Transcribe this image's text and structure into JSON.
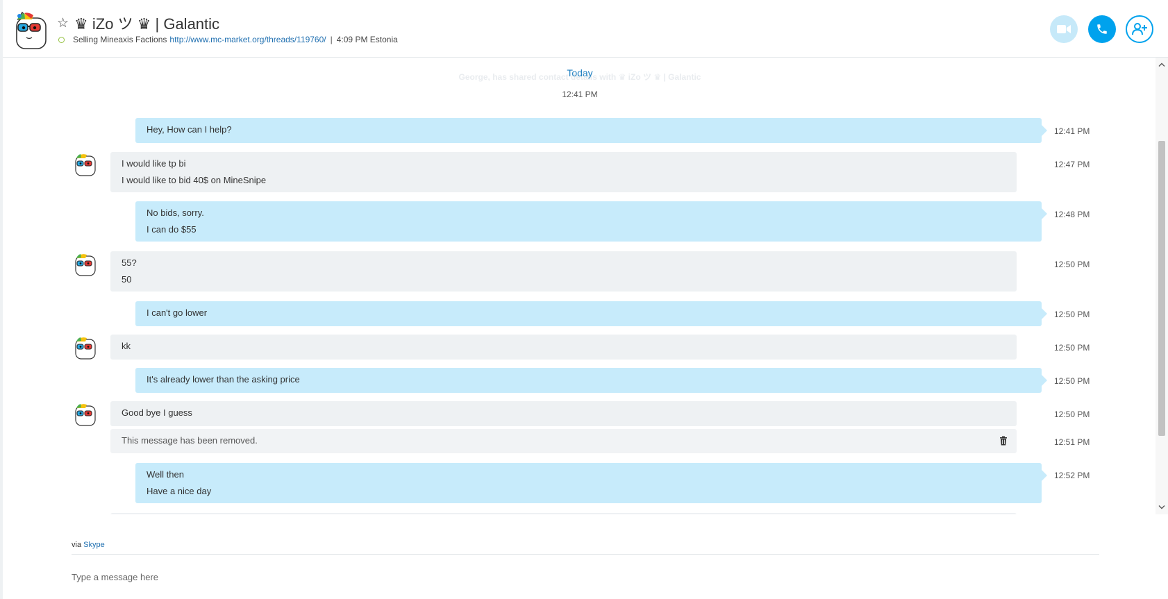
{
  "header": {
    "favorite_icon": "star-outline-icon",
    "contact_name": "♛ iZo ツ ♛ | Galantic",
    "presence_icon": "presence-online-ring-icon",
    "mood_text": "Selling Mineaxis Factions",
    "mood_link": "http://www.mc-market.org/threads/119760/",
    "separator": "|",
    "local_time": "4:09 PM Estonia",
    "buttons": {
      "video": "video-call-icon",
      "call": "phone-icon",
      "add": "add-person-icon"
    },
    "accent_color": "#00a2ed",
    "video_disabled_color": "#c6e9f9"
  },
  "conversation": {
    "day_label": "Today",
    "ghost_notice": "George, has shared contact details with ♛ iZo ツ ♛ | Galantic",
    "day_time": "12:41 PM",
    "messages": [
      {
        "direction": "outgoing",
        "lines": [
          "Hey, How can I help?"
        ],
        "time": "12:41 PM"
      },
      {
        "direction": "incoming",
        "lines": [
          "I would like tp bi",
          "I would like to bid 40$ on MineSnipe"
        ],
        "time": "12:47 PM"
      },
      {
        "direction": "outgoing",
        "lines": [
          "No bids, sorry.",
          "I can do $55"
        ],
        "time": "12:48 PM"
      },
      {
        "direction": "incoming",
        "lines": [
          "55?",
          "50"
        ],
        "time": "12:50 PM"
      },
      {
        "direction": "outgoing",
        "lines": [
          "I can't go lower"
        ],
        "time": "12:50 PM"
      },
      {
        "direction": "incoming",
        "lines": [
          "kk"
        ],
        "time": "12:50 PM"
      },
      {
        "direction": "outgoing",
        "lines": [
          "It's already lower than the asking price"
        ],
        "time": "12:50 PM"
      },
      {
        "direction": "incoming",
        "lines": [
          "Good bye I guess"
        ],
        "time": "12:50 PM"
      },
      {
        "direction": "incoming",
        "removed": true,
        "lines": [
          "This message has been removed."
        ],
        "time": "12:51 PM"
      },
      {
        "direction": "outgoing",
        "lines": [
          "Well then",
          "Have a nice day"
        ],
        "time": "12:52 PM"
      }
    ],
    "outgoing_color": "#c7ebfb",
    "incoming_color": "#eef1f3"
  },
  "composer": {
    "via_prefix": "via",
    "via_link": "Skype",
    "placeholder": "Type a message here",
    "value": ""
  }
}
